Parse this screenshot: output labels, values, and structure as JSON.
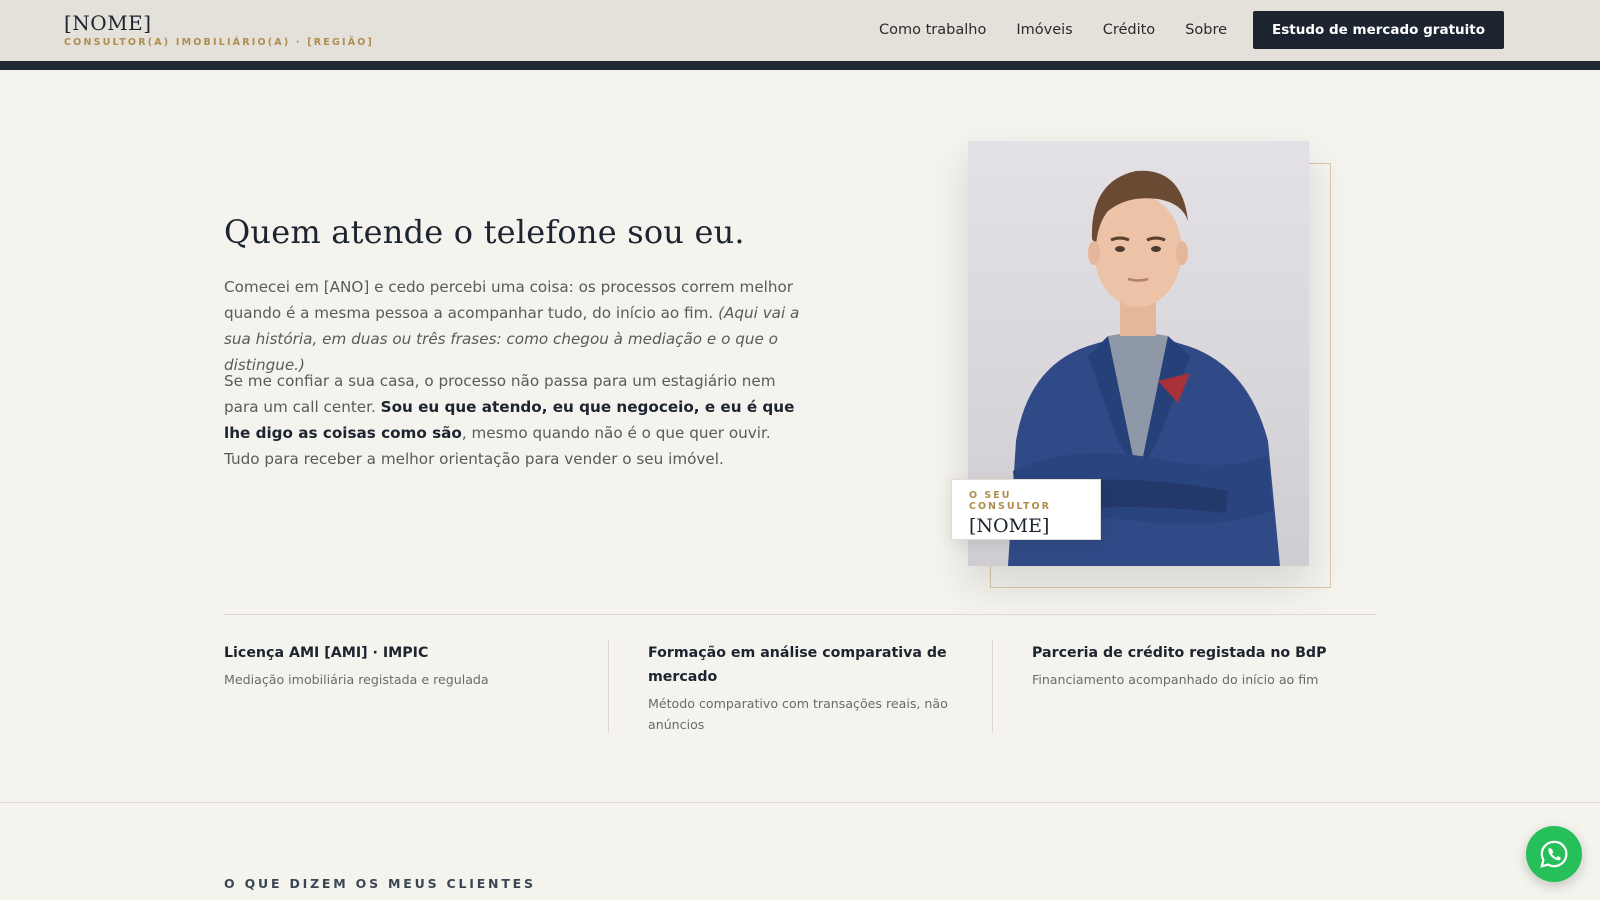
{
  "header": {
    "brand_name": "[NOME]",
    "brand_subtitle": "CONSULTOR(A) IMOBILIÁRIO(A) · [REGIÃO]",
    "nav": [
      "Como trabalho",
      "Imóveis",
      "Crédito",
      "Sobre"
    ],
    "cta_label": "Estudo de mercado gratuito"
  },
  "about": {
    "title": "Quem atende o telefone sou eu.",
    "p1_text": "Comecei em [ANO] e cedo percebi uma coisa: os processos correm melhor quando é a mesma pessoa a acompanhar tudo, do início ao fim.",
    "p1_italic": "(Aqui vai a sua história, em duas ou três frases: como chegou à mediação e o que o distingue.)",
    "p2_start": "Se me confiar a sua casa, o processo não passa para um estagiário nem para um call center.",
    "p2_bold": "Sou eu que atendo, eu que negoceio, e eu é que lhe digo as coisas como são",
    "p2_end": ", mesmo quando não é o que quer ouvir.",
    "p3": "Tudo para receber a melhor orientação para vender o seu imóvel."
  },
  "consultant_card": {
    "label": "O SEU CONSULTOR",
    "name": "[NOME]"
  },
  "credentials": [
    {
      "title": "Licença AMI [AMI] · IMPIC",
      "desc": "Mediação imobiliária registada e regulada"
    },
    {
      "title": "Formação em análise comparativa de mercado",
      "desc": "Método comparativo com transações reais, não anúncios"
    },
    {
      "title": "Parceria de crédito registada no BdP",
      "desc": "Financiamento acompanhado do início ao fim"
    }
  ],
  "testimonials": {
    "label": "O QUE DIZEM OS MEUS CLIENTES"
  },
  "colors": {
    "navy": "#1c2430",
    "gold": "#b08d4e",
    "background": "#f5f3ee",
    "whatsapp": "#25c05a"
  },
  "icons": {
    "whatsapp": "whatsapp-icon"
  }
}
